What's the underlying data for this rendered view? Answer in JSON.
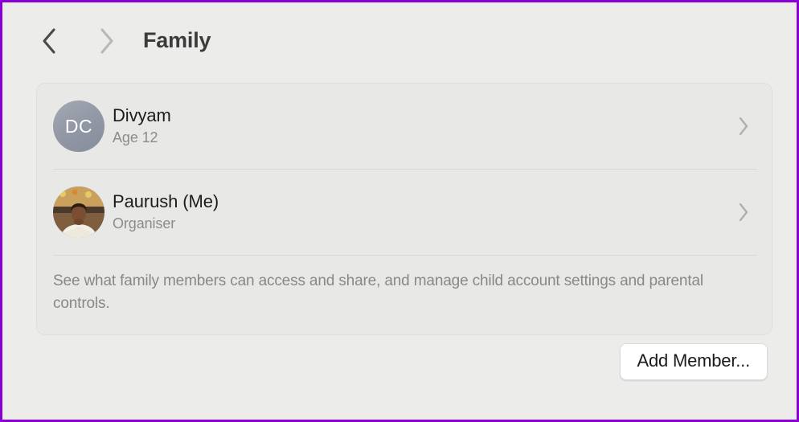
{
  "window": {
    "accent_border_color": "#8a00d4",
    "background_color": "#ececea"
  },
  "header": {
    "back_icon": "chevron-left-icon",
    "forward_icon": "chevron-right-icon",
    "back_enabled": true,
    "forward_enabled": false,
    "title": "Family"
  },
  "card": {
    "background_color": "#e8e8e6",
    "members": [
      {
        "avatar_type": "initials",
        "initials": "DC",
        "avatar_color": "#9399a6",
        "name": "Divyam",
        "subtitle": "Age 12",
        "disclosure_icon": "chevron-right-icon"
      },
      {
        "avatar_type": "photo",
        "initials": "",
        "avatar_color": "#c7b49a",
        "name": "Paurush (Me)",
        "subtitle": "Organiser",
        "disclosure_icon": "chevron-right-icon"
      }
    ],
    "footnote": "See what family members can access and share, and manage child account settings and parental controls."
  },
  "footer": {
    "add_member_label": "Add Member..."
  }
}
